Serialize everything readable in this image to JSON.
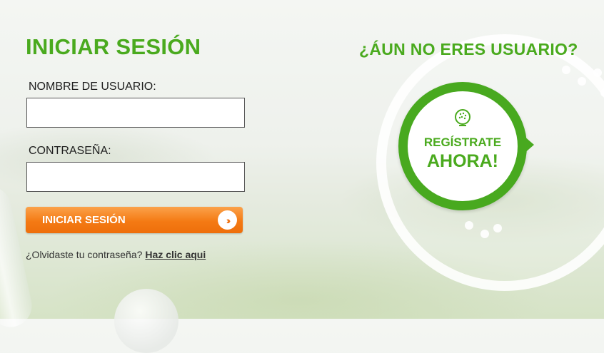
{
  "login": {
    "title": "INICIAR SESIÓN",
    "username_label": "NOMBRE DE USUARIO:",
    "username_value": "",
    "password_label": "CONTRASEÑA:",
    "password_value": "",
    "submit_label": "INICIAR SESIÓN",
    "submit_icon": "double-chevron-right-icon",
    "forgot_text": "¿Olvidaste tu contraseña?",
    "forgot_link": "Haz clic aqui"
  },
  "register": {
    "title": "¿ÁUN NO ERES USUARIO?",
    "badge_line1": "REGÍSTRATE",
    "badge_line2": "AHORA!",
    "badge_icon": "golf-ball-icon"
  },
  "colors": {
    "brand_green": "#4aaa1e",
    "button_orange": "#f47a14",
    "background": "#eef1ec"
  }
}
